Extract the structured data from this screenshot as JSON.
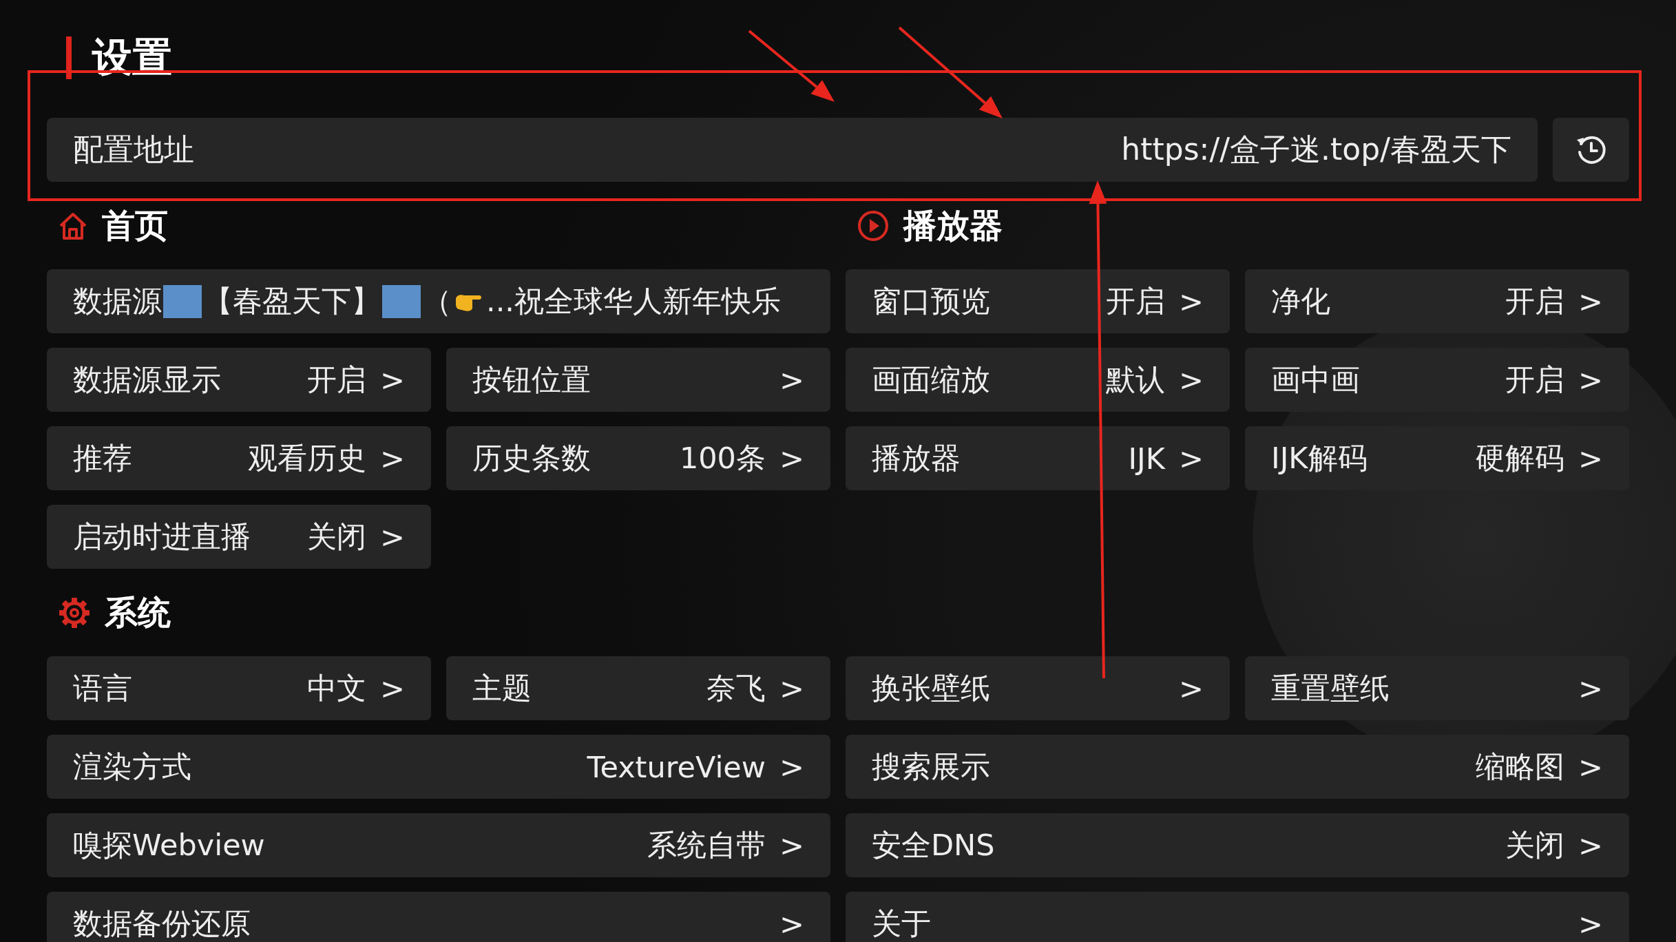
{
  "title": "设置",
  "config": {
    "label": "配置地址",
    "value": "https://盒子迷.top/春盈天下"
  },
  "sections": [
    {
      "title": "首页",
      "items": [
        {
          "kind": "source",
          "label": "数据源",
          "parts": [
            {
              "kind": "square"
            },
            {
              "kind": "text",
              "text": "【春盈天下】"
            },
            {
              "kind": "square"
            },
            {
              "kind": "text",
              "text": "（"
            },
            {
              "kind": "hand"
            },
            {
              "kind": "text",
              "text": "...祝全球华人新年快乐"
            }
          ]
        },
        {
          "kind": "normal",
          "label": "数据源显示",
          "value": "开启",
          "arrow": ">"
        },
        {
          "kind": "normal",
          "label": "按钮位置",
          "arrow": ">"
        },
        {
          "kind": "normal",
          "label": "推荐",
          "value": "观看历史",
          "arrow": ">"
        },
        {
          "kind": "normal",
          "label": "历史条数",
          "value": "100条",
          "arrow": ">"
        },
        {
          "kind": "normal",
          "label": "启动时进直播",
          "value": "关闭",
          "arrow": ">"
        }
      ]
    },
    {
      "title": "播放器",
      "items": [
        {
          "kind": "normal",
          "label": "窗口预览",
          "value": "开启",
          "arrow": ">"
        },
        {
          "kind": "normal",
          "label": "净化",
          "value": "开启",
          "arrow": ">"
        },
        {
          "kind": "normal",
          "label": "画面缩放",
          "value": "默认",
          "arrow": ">"
        },
        {
          "kind": "normal",
          "label": "画中画",
          "value": "开启",
          "arrow": ">"
        },
        {
          "kind": "normal",
          "label": "播放器",
          "value": "IJK",
          "arrow": ">"
        },
        {
          "kind": "normal",
          "label": "IJK解码",
          "value": "硬解码",
          "arrow": ">"
        }
      ]
    },
    {
      "title": "系统",
      "items": [
        {
          "kind": "normal",
          "label": "语言",
          "value": "中文",
          "arrow": ">"
        },
        {
          "kind": "normal",
          "label": "主题",
          "value": "奈飞",
          "arrow": ">"
        },
        {
          "kind": "normal",
          "label": "换张壁纸",
          "arrow": ">"
        },
        {
          "kind": "normal",
          "label": "重置壁纸",
          "arrow": ">"
        },
        {
          "kind": "wide",
          "label": "渲染方式",
          "value": "TextureView",
          "arrow": ">"
        },
        {
          "kind": "wide",
          "label": "搜索展示",
          "value": "缩略图",
          "arrow": ">"
        },
        {
          "kind": "wide",
          "label": "嗅探Webview",
          "value": "系统自带",
          "arrow": ">"
        },
        {
          "kind": "wide",
          "label": "安全DNS",
          "value": "关闭",
          "arrow": ">"
        },
        {
          "kind": "wide",
          "label": "数据备份还原",
          "arrow": ">"
        },
        {
          "kind": "wide",
          "label": "关于",
          "arrow": ">"
        }
      ]
    }
  ]
}
